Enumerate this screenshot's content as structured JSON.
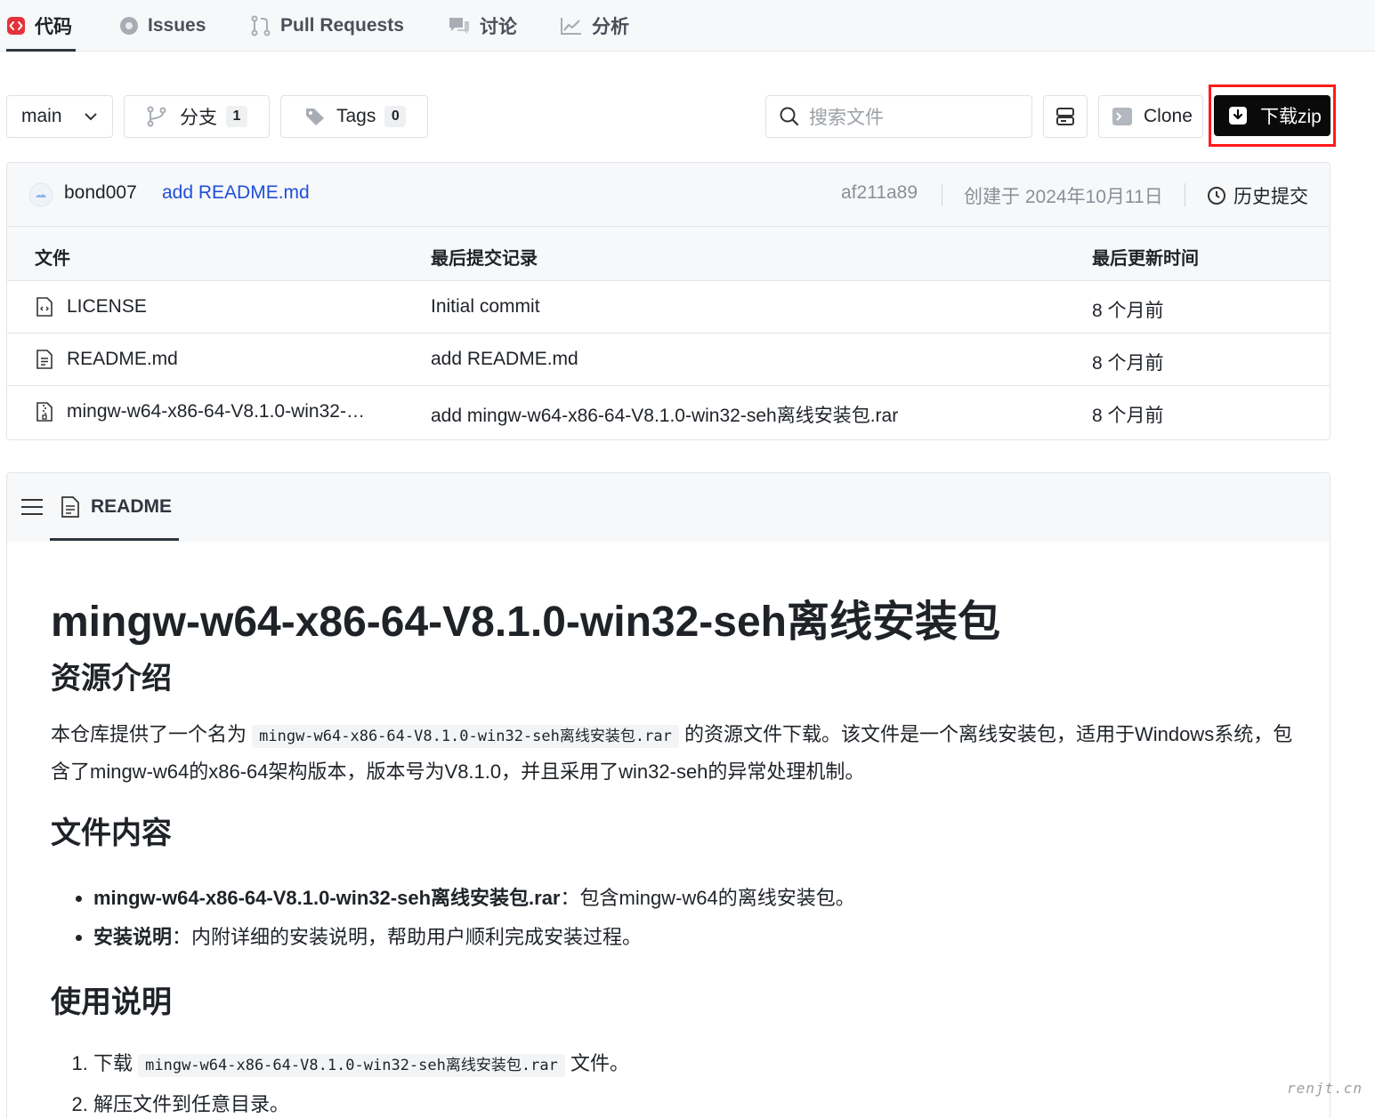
{
  "nav": {
    "tabs": [
      {
        "label": "代码",
        "icon": "code-icon"
      },
      {
        "label": "Issues",
        "icon": "issue-icon"
      },
      {
        "label": "Pull Requests",
        "icon": "pull-request-icon"
      },
      {
        "label": "讨论",
        "icon": "discussion-icon"
      },
      {
        "label": "分析",
        "icon": "chart-icon"
      }
    ],
    "active_tab": "代码"
  },
  "toolbar": {
    "branch": "main",
    "branches_label": "分支",
    "branches_count": "1",
    "tags_label": "Tags",
    "tags_count": "0",
    "search_placeholder": "搜索文件",
    "clone_label": "Clone",
    "download_label": "下载zip"
  },
  "commit": {
    "author": "bond007",
    "message": "add README.md",
    "hash": "af211a89",
    "created": "创建于 2024年10月11日",
    "history_label": "历史提交"
  },
  "table": {
    "headers": [
      "文件",
      "最后提交记录",
      "最后更新时间"
    ],
    "rows": [
      {
        "name": "LICENSE",
        "commit": "Initial commit",
        "time": "8 个月前",
        "icon": "license-file-icon"
      },
      {
        "name": "README.md",
        "commit": "add README.md",
        "time": "8 个月前",
        "icon": "text-file-icon"
      },
      {
        "name": "mingw-w64-x86-64-V8.1.0-win32-…",
        "commit": "add mingw-w64-x86-64-V8.1.0-win32-seh离线安装包.rar",
        "time": "8 个月前",
        "icon": "archive-file-icon"
      }
    ]
  },
  "readme": {
    "tab_label": "README",
    "title": "mingw-w64-x86-64-V8.1.0-win32-seh离线安装包",
    "h2_intro": "资源介绍",
    "intro_before": "本仓库提供了一个名为 ",
    "intro_code": "mingw-w64-x86-64-V8.1.0-win32-seh离线安装包.rar",
    "intro_after": " 的资源文件下载。该文件是一个离线安装包，适用于Windows系统，包含了mingw-w64的x86-64架构版本，版本号为V8.1.0，并且采用了win32-seh的异常处理机制。",
    "h2_content": "文件内容",
    "bullets": [
      {
        "bold": "mingw-w64-x86-64-V8.1.0-win32-seh离线安装包.rar",
        "text": "：包含mingw-w64的离线安装包。"
      },
      {
        "bold": "安装说明",
        "text": "：内附详细的安装说明，帮助用户顺利完成安装过程。"
      }
    ],
    "h2_usage": "使用说明",
    "steps": [
      {
        "before": "下载 ",
        "code": "mingw-w64-x86-64-V8.1.0-win32-seh离线安装包.rar",
        "after": " 文件。"
      },
      {
        "text": "解压文件到任意目录。"
      }
    ]
  },
  "watermark": "renjt.cn",
  "colors": {
    "accent_red": "#ff1a1a",
    "link_blue": "#1f4fd8",
    "download_bg": "#0a0a0a"
  }
}
